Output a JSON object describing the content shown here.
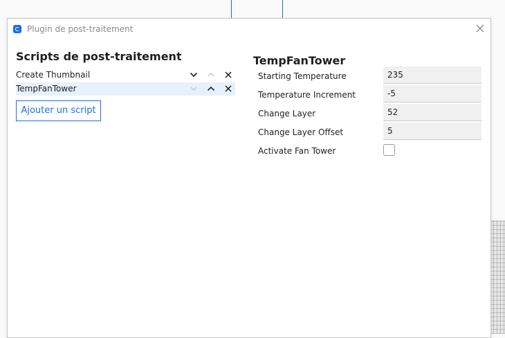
{
  "window": {
    "title": "Plugin de post-traitement"
  },
  "scripts": {
    "heading": "Scripts de post-traitement",
    "items": [
      {
        "label": "Create Thumbnail",
        "selected": false
      },
      {
        "label": "TempFanTower",
        "selected": true
      }
    ],
    "add_button": "Ajouter un script"
  },
  "settings": {
    "heading": "TempFanTower",
    "fields": [
      {
        "label": "Starting Temperature",
        "value": "235"
      },
      {
        "label": "Temperature Increment",
        "value": "-5"
      },
      {
        "label": "Change Layer",
        "value": "52"
      },
      {
        "label": "Change Layer Offset",
        "value": "5"
      }
    ],
    "checkbox": {
      "label": "Activate Fan Tower",
      "checked": false
    }
  },
  "icons": {
    "move_down": "chevron-down-icon",
    "move_up": "chevron-up-icon",
    "remove": "close-icon",
    "app": "cura-logo-icon"
  },
  "colors": {
    "accent": "#196ef0",
    "selected_row": "#e8f0fc",
    "input_bg": "#f0f0f0",
    "disabled_icon": "#c4c4c4"
  }
}
